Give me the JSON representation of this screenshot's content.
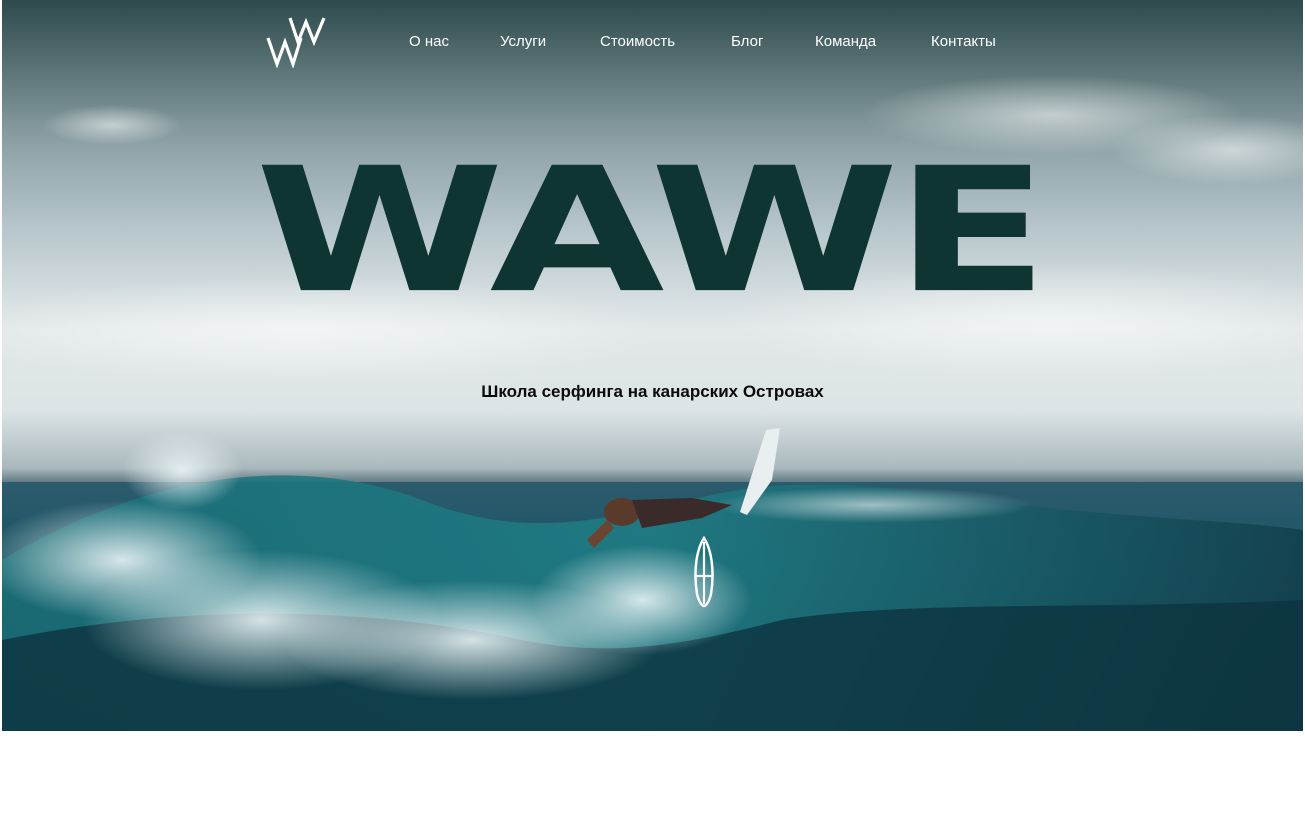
{
  "header": {
    "logo_icon": "ww-monogram-logo",
    "nav": [
      {
        "label": "О нас"
      },
      {
        "label": "Услуги"
      },
      {
        "label": "Стоимость"
      },
      {
        "label": "Блог"
      },
      {
        "label": "Команда"
      },
      {
        "label": "Контакты"
      }
    ]
  },
  "hero": {
    "title": "WAWE",
    "subtitle": "Школа серфинга на канарских Островах",
    "scroll_icon": "surfboard-icon"
  },
  "colors": {
    "title": "#0f3532",
    "nav_text": "#ffffff",
    "subtitle": "#0b0b0b",
    "sea": "#12404c"
  }
}
